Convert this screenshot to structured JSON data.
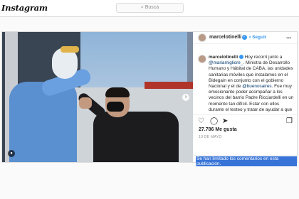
{
  "app": {
    "logo": "Instagram"
  },
  "search": {
    "placeholder": "Busca",
    "icon": "search-icon"
  },
  "post": {
    "username": "marcelotinelli",
    "follow_label": "Seguir",
    "follow_sep": "•",
    "more_label": "...",
    "verified_mark": "✓",
    "caption": {
      "username": "marcelotinelli",
      "part1": "Hoy recorrí junto a",
      "mention1": "@mariamigliore_",
      "part2": ". Ministra de Desarrollo Humano y Hábitat de CABA, las unidades sanitarias móviles que instalamos en el Bidegain en conjunto con el gobierno Nacional y el de",
      "mention2": "@buenosaires",
      "part3": ". Fue muy emocionante poder acompañar a los vecinos del barrio Padre Ricciardelli en un momento tan difícil. Estar con ellos durante el testeo y tratar de ayudar a que estén tranquilos, contenidos, que"
    },
    "likes": "27.786 Me gusta",
    "date": "10 DE MAYO",
    "comments_limited": "Se han limitado los comentarios en esta publicación.",
    "photo_next_arrow": "›",
    "tag_icon_glyph": "●"
  },
  "colors": {
    "accent": "#3897f0",
    "highlight": "#3874d8",
    "border": "#dbdbdb"
  }
}
